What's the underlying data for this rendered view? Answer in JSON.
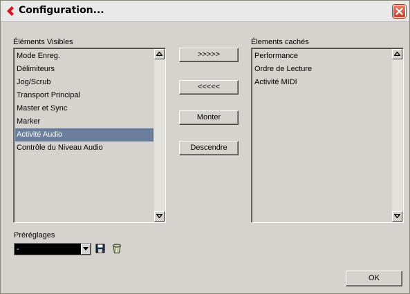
{
  "window": {
    "title": "Configuration...",
    "close_icon": "close-icon",
    "app_icon": "steinberg-logo-icon"
  },
  "visible": {
    "label": "Éléments Visibles",
    "items": [
      "Mode Enreg.",
      "Délimiteurs",
      "Jog/Scrub",
      "Transport Principal",
      "Master et Sync",
      "Marker",
      "Activité Audio",
      "Contrôle du Niveau Audio"
    ],
    "selected": "Activité Audio"
  },
  "hidden": {
    "label": "Élements cachés",
    "items": [
      "Performance",
      "Ordre de Lecture",
      "Activité MIDI"
    ]
  },
  "buttons": {
    "move_right": ">>>>>",
    "move_left": "<<<<<",
    "up": "Monter",
    "down": "Descendre",
    "ok": "OK"
  },
  "presets": {
    "label": "Préréglages",
    "value": "-",
    "save_icon": "save-icon",
    "delete_icon": "trash-icon"
  },
  "colors": {
    "selection": "#6b7e9c",
    "dialog_bg": "#d6d3ce",
    "close_button": "#c6432c",
    "logo": "#d8141c"
  }
}
